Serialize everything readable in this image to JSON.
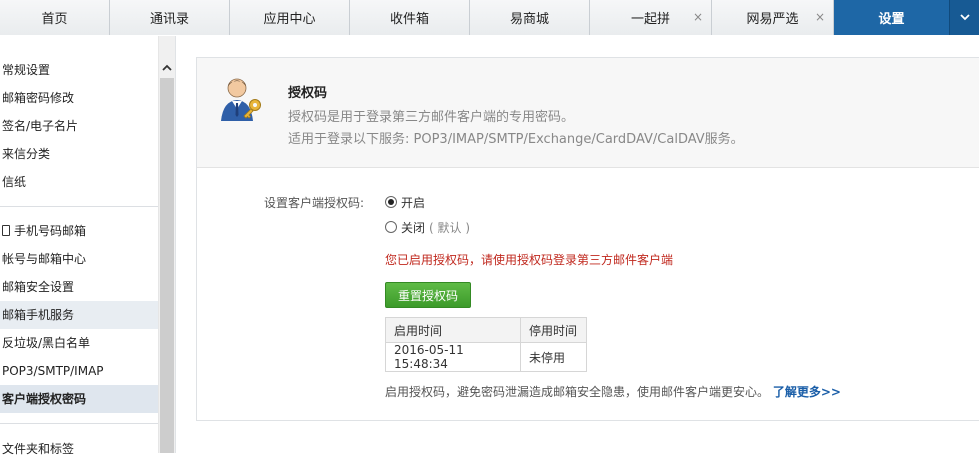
{
  "tabs": [
    {
      "label": "首页",
      "closable": false
    },
    {
      "label": "通讯录",
      "closable": false
    },
    {
      "label": "应用中心",
      "closable": false
    },
    {
      "label": "收件箱",
      "closable": false
    },
    {
      "label": "易商城",
      "closable": false
    },
    {
      "label": "一起拼",
      "closable": true
    },
    {
      "label": "网易严选",
      "closable": true
    },
    {
      "label": "设置",
      "closable": false,
      "active": true
    }
  ],
  "tab_close_glyph": "×",
  "sidebar": {
    "items": [
      {
        "label": "常规设置"
      },
      {
        "label": "邮箱密码修改"
      },
      {
        "label": "签名/电子名片"
      },
      {
        "label": "来信分类"
      },
      {
        "label": "信纸"
      },
      {
        "label": "手机号码邮箱",
        "icon": "phone-icon"
      },
      {
        "label": "帐号与邮箱中心"
      },
      {
        "label": "邮箱安全设置"
      },
      {
        "label": "邮箱手机服务",
        "state": "hover"
      },
      {
        "label": "反垃圾/黑白名单"
      },
      {
        "label": "POP3/SMTP/IMAP"
      },
      {
        "label": "客户端授权密码",
        "state": "selected"
      },
      {
        "label": "文件夹和标签"
      }
    ]
  },
  "panel": {
    "title": "授权码",
    "description": "授权码是用于登录第三方邮件客户端的专用密码。",
    "services": "适用于登录以下服务: POP3/IMAP/SMTP/Exchange/CardDAV/CalDAV服务。",
    "form_label": "设置客户端授权码:",
    "option_on": "开启",
    "option_off": "关闭",
    "option_off_default": "( 默认 )",
    "selected_option": "on",
    "warning": "您已启用授权码，请使用授权码登录第三方邮件客户端",
    "reset_button": "重置授权码",
    "table": {
      "headers": [
        "启用时间",
        "停用时间"
      ],
      "rows": [
        [
          "2016-05-11 15:48:34",
          "未停用"
        ]
      ]
    },
    "footer_text": "启用授权码，避免密码泄漏造成邮箱安全隐患，使用邮件客户端更安心。",
    "footer_link": "了解更多>>"
  },
  "colors": {
    "accent_tab": "#1e67a6",
    "warning": "#c0281e",
    "button_green": "#4caa37",
    "link": "#1a5ea8"
  }
}
